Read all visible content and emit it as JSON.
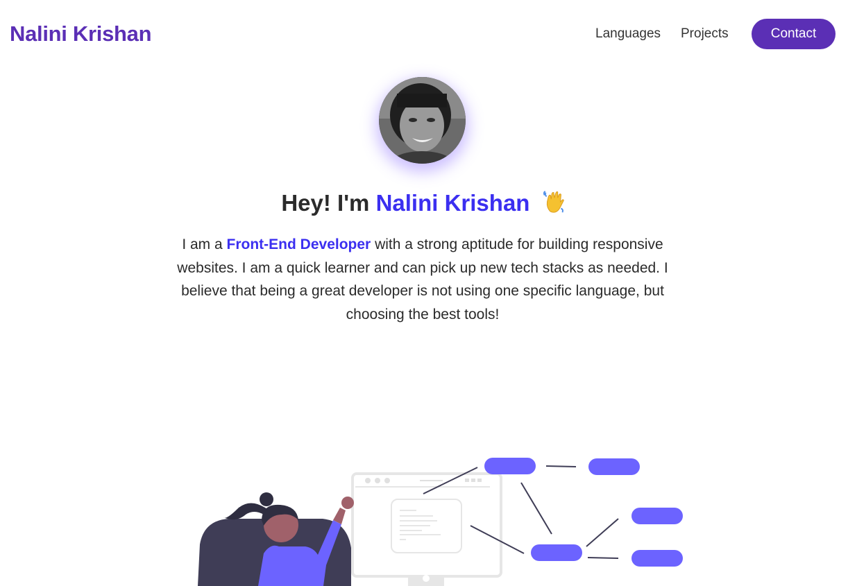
{
  "nav": {
    "brand": "Nalini Krishan",
    "links": [
      "Languages",
      "Projects"
    ],
    "contact_label": "Contact"
  },
  "hero": {
    "greeting": "Hey! I'm",
    "name": "Nalini Krishan",
    "wave_icon": "waving-hand-icon"
  },
  "intro": {
    "before": "I am a",
    "role": "Front-End Developer",
    "after": "with a strong aptitude for building responsive websites. I am a quick learner and can pick up new tech stacks as needed. I believe that being a great developer is not using one specific language, but choosing the best tools!"
  },
  "colors": {
    "brand": "#5b2fb5",
    "accent": "#3b2ff0",
    "illustration": "#6c63ff"
  }
}
